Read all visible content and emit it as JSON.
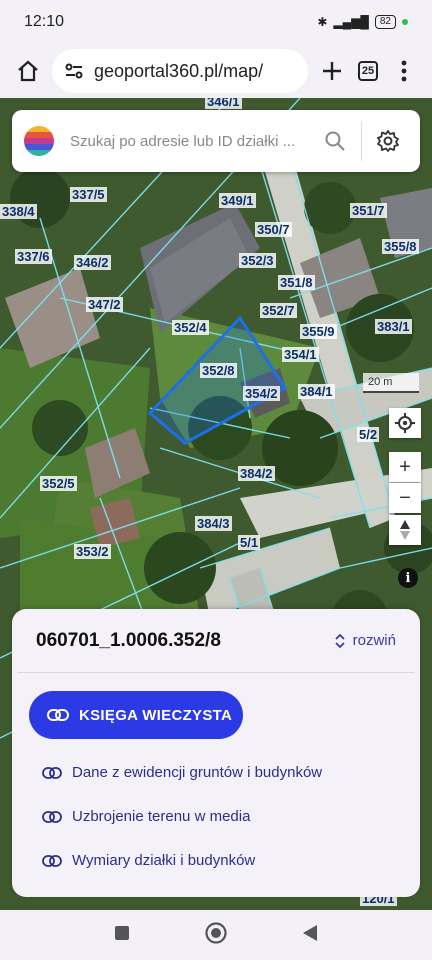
{
  "status": {
    "time": "12:10",
    "battery": "82"
  },
  "browser": {
    "url": "geoportal360.pl/map/",
    "tabs_count": "25"
  },
  "search": {
    "placeholder": "Szukaj po adresie lub ID działki ..."
  },
  "map": {
    "scale_label": "20 m",
    "parcel_labels": [
      "346/1",
      "337/5",
      "349/1",
      "351/7",
      "338/4",
      "350/7",
      "355/8",
      "337/6",
      "346/2",
      "352/3",
      "351/8",
      "347/2",
      "352/7",
      "383/1",
      "352/4",
      "355/9",
      "354/1",
      "352/8",
      "354/2",
      "384/1",
      "5/2",
      "384/2",
      "352/5",
      "384/3",
      "5/1",
      "353/2",
      "120/1"
    ]
  },
  "panel": {
    "parcel_id": "060701_1.0006.352/8",
    "expand_label": "rozwiń",
    "kw_button": "KSIĘGA WIECZYSTA",
    "links": [
      "Dane z ewidencji gruntów i budynków",
      "Uzbrojenie terenu w media",
      "Wymiary działki i budynków"
    ]
  },
  "colors": {
    "accent": "#2c3ae6",
    "link": "#2a2f8f",
    "selection": "#1e6fe8"
  }
}
